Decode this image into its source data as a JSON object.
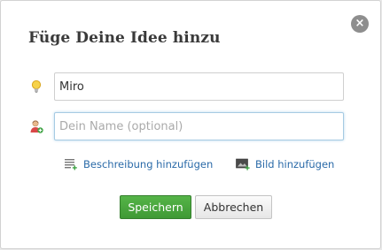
{
  "dialog": {
    "title": "Füge Deine Idee hinzu",
    "close_label": "×"
  },
  "form": {
    "idea_value": "Miro",
    "name_placeholder": "Dein Name (optional)",
    "idea_icon": "lightbulb-icon",
    "name_icon": "user-icon"
  },
  "links": {
    "description_label": "Beschreibung hinzufügen",
    "description_icon": "text-lines-icon",
    "image_label": "Bild hinzufügen",
    "image_icon": "image-icon"
  },
  "buttons": {
    "save_label": "Speichern",
    "cancel_label": "Abbrechen"
  },
  "colors": {
    "save_button": "#4aa83e",
    "link": "#2a6aa8",
    "focus_border": "#a6cbe3"
  }
}
